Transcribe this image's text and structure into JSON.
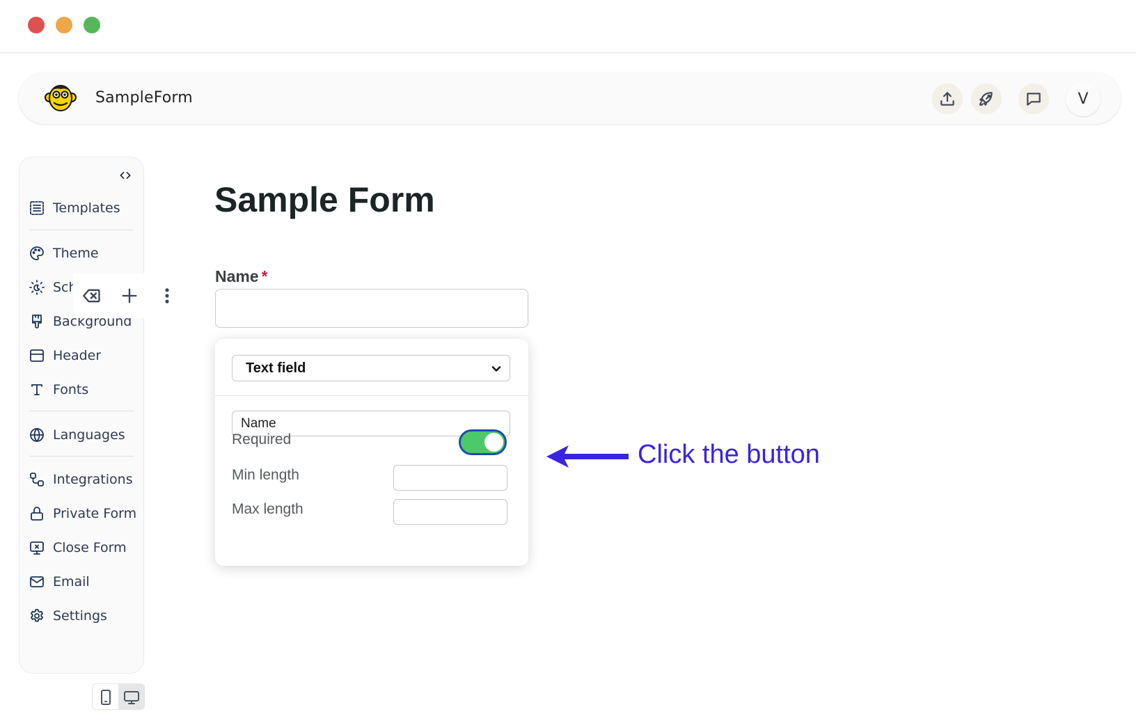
{
  "window": {
    "controls": [
      "close",
      "minimize",
      "maximize"
    ]
  },
  "header": {
    "logo_icon": "monkey-face-icon",
    "app_title": "SampleForm",
    "actions": [
      {
        "id": "publish",
        "icon": "upload-icon"
      },
      {
        "id": "launch",
        "icon": "rocket-icon"
      },
      {
        "id": "feedback",
        "icon": "chat-bubble-icon"
      }
    ],
    "avatar_initial": "V"
  },
  "sidebar": {
    "collapse_icon": "code-brackets-icon",
    "items": [
      {
        "label": "Templates",
        "icon": "dashed-list-icon"
      },
      {
        "label": "Theme",
        "icon": "palette-icon"
      },
      {
        "label": "Sch",
        "full_label_truncated": true,
        "icon": "sun-moon-icon"
      },
      {
        "label": "Background",
        "icon": "paintbrush-icon"
      },
      {
        "label": "Header",
        "icon": "layout-header-icon"
      },
      {
        "label": "Fonts",
        "icon": "type-icon"
      },
      {
        "label": "Languages",
        "icon": "globe-icon"
      },
      {
        "label": "Integrations",
        "icon": "integration-nodes-icon"
      },
      {
        "label": "Private Form",
        "icon": "lock-icon"
      },
      {
        "label": "Close Form",
        "icon": "monitor-x-icon"
      },
      {
        "label": "Email",
        "icon": "mail-icon"
      },
      {
        "label": "Settings",
        "icon": "gear-icon"
      }
    ]
  },
  "field_toolbar": {
    "buttons": [
      {
        "id": "delete",
        "icon": "backspace-x-icon"
      },
      {
        "id": "add",
        "icon": "plus-icon"
      },
      {
        "id": "more",
        "icon": "vertical-dots-icon"
      }
    ]
  },
  "device_toggle": {
    "options": [
      {
        "id": "mobile",
        "icon": "phone-icon",
        "active": false
      },
      {
        "id": "desktop",
        "icon": "monitor-icon",
        "active": true
      }
    ]
  },
  "form": {
    "title": "Sample Form",
    "field": {
      "label": "Name",
      "required_marker": "*",
      "value": ""
    }
  },
  "field_settings": {
    "type_select": {
      "selected": "Text field"
    },
    "label_value": "Name",
    "required": {
      "label": "Required",
      "on": true
    },
    "min_length": {
      "label": "Min length",
      "value": ""
    },
    "max_length": {
      "label": "Max length",
      "value": ""
    }
  },
  "annotation": {
    "text": "Click the button",
    "color": "#3a24de",
    "arrow_direction": "left"
  },
  "colors": {
    "toggle_on": "#4cc968",
    "toggle_border": "#1c4ea5",
    "required_star": "#c0254a",
    "sidebar_icon": "#1e3357"
  }
}
